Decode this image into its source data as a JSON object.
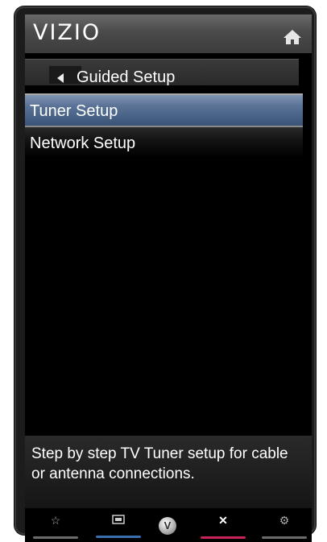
{
  "header": {
    "logo": "VIZIO",
    "home_icon": "home-icon"
  },
  "breadcrumb": {
    "back_icon": "left-arrow-icon",
    "title": "Guided Setup"
  },
  "menu": {
    "items": [
      {
        "label": "Tuner Setup",
        "selected": true
      },
      {
        "label": "Network Setup",
        "selected": false
      }
    ]
  },
  "description": {
    "text": "Step by step TV Tuner setup for cable or antenna connections."
  },
  "bottom_bar": {
    "buttons": [
      {
        "icon": "star-icon",
        "underline_color": "#6b6b6b"
      },
      {
        "icon": "input-icon",
        "underline_color": "#3a6fb0"
      },
      {
        "icon": "vizio-v-icon",
        "label": "V"
      },
      {
        "icon": "close-icon",
        "underline_color": "#c8235a"
      },
      {
        "icon": "gear-icon",
        "underline_color": "#6b6b6b"
      }
    ]
  },
  "colors": {
    "selected_item": "#5a7396",
    "header": "#4a4a4a"
  }
}
